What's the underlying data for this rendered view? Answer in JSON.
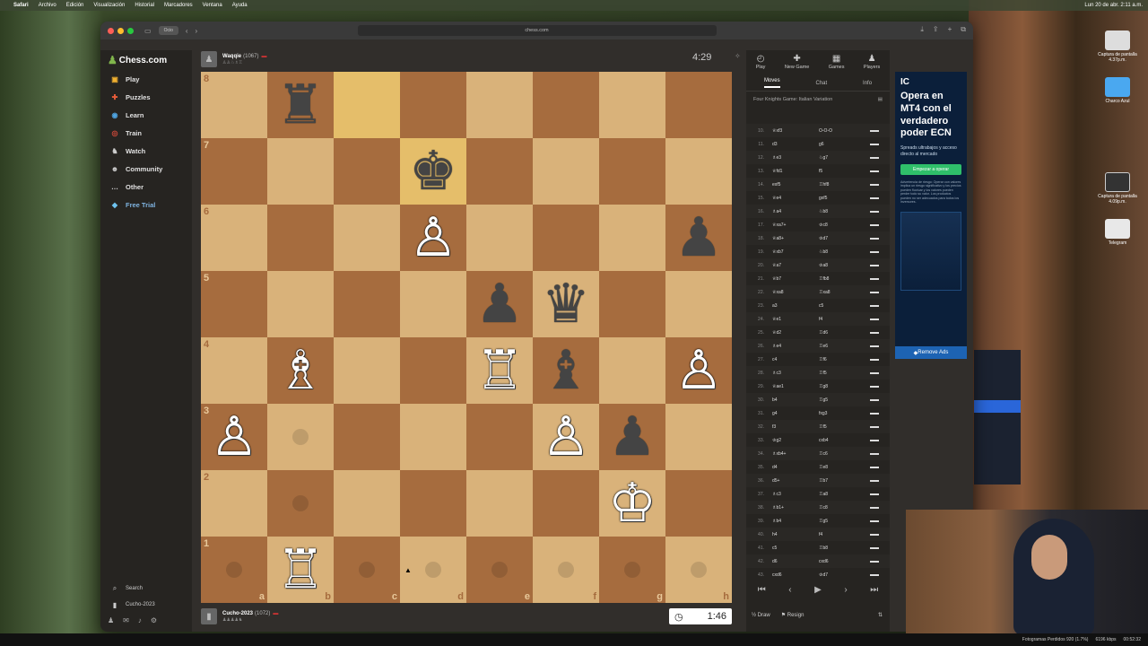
{
  "menubar": {
    "app": "Safari",
    "items": [
      "Archivo",
      "Edición",
      "Visualización",
      "Historial",
      "Marcadores",
      "Ventana",
      "Ayuda"
    ],
    "clock": "Lun 20 de abr. 2:11 a.m."
  },
  "browser": {
    "tab_group": "Ocio",
    "url": "chess.com"
  },
  "sidebar": {
    "logo": "Chess.com",
    "items": [
      {
        "label": "Play",
        "icon": "play-icon"
      },
      {
        "label": "Puzzles",
        "icon": "puzzle-icon"
      },
      {
        "label": "Learn",
        "icon": "learn-icon"
      },
      {
        "label": "Train",
        "icon": "train-icon"
      },
      {
        "label": "Watch",
        "icon": "watch-icon"
      },
      {
        "label": "Community",
        "icon": "community-icon"
      },
      {
        "label": "Other",
        "icon": "more-icon"
      },
      {
        "label": "Free Trial",
        "icon": "diamond-icon"
      }
    ],
    "search": "Search",
    "user": "Cucho-2023"
  },
  "players": {
    "top": {
      "name": "Waqqie",
      "rating": "(1067)",
      "clock": "4:29"
    },
    "bottom": {
      "name": "Cucho-2023",
      "rating": "(1072)",
      "clock": "1:46"
    }
  },
  "board": {
    "ranks": [
      "8",
      "7",
      "6",
      "5",
      "4",
      "3",
      "2",
      "1"
    ],
    "files": [
      "a",
      "b",
      "c",
      "d",
      "e",
      "f",
      "g",
      "h"
    ],
    "pieces": {
      "b8": "♜b",
      "d7": "♚b",
      "d6": "♙w",
      "h6": "♟b",
      "e5": "♟b",
      "f5": "♛b",
      "b4": "♗w",
      "e4": "♖w",
      "f4": "♝b",
      "h4": "♙w",
      "a3": "♙w",
      "f3": "♙w",
      "g3": "♟b",
      "g2": "♔w",
      "b1": "♖w"
    },
    "highlights": [
      "c8",
      "d7"
    ],
    "hints": [
      "b3",
      "b2",
      "a1",
      "c1",
      "d1",
      "e1",
      "f1",
      "g1",
      "h1"
    ]
  },
  "right_panel": {
    "top_tabs": [
      "Play",
      "New Game",
      "Games",
      "Players"
    ],
    "tabs": [
      "Moves",
      "Chat",
      "Info"
    ],
    "opening": "Four Knights Game: Italian Variation",
    "moves": [
      {
        "n": "10.",
        "w": "♕xf3",
        "b": "O-O-O"
      },
      {
        "n": "11.",
        "w": "d3",
        "b": "g6"
      },
      {
        "n": "12.",
        "w": "♗e3",
        "b": "♘g7"
      },
      {
        "n": "13.",
        "w": "♕fd1",
        "b": "f5"
      },
      {
        "n": "14.",
        "w": "exf5",
        "b": "♖hf8"
      },
      {
        "n": "15.",
        "w": "♕e4",
        "b": "gxf5"
      },
      {
        "n": "16.",
        "w": "♗a4",
        "b": "♘b8"
      },
      {
        "n": "17.",
        "w": "♕xa7+",
        "b": "♔c8"
      },
      {
        "n": "18.",
        "w": "♕a8+",
        "b": "♔d7"
      },
      {
        "n": "19.",
        "w": "♕xb7",
        "b": "♘b8"
      },
      {
        "n": "20.",
        "w": "♕a7",
        "b": "♔a8"
      },
      {
        "n": "21.",
        "w": "♕b7",
        "b": "♖fb8"
      },
      {
        "n": "22.",
        "w": "♕xa8",
        "b": "♖xa8"
      },
      {
        "n": "23.",
        "w": "a3",
        "b": "c5"
      },
      {
        "n": "24.",
        "w": "♕e1",
        "b": "f4"
      },
      {
        "n": "25.",
        "w": "♕d2",
        "b": "♖d6"
      },
      {
        "n": "26.",
        "w": "♗e4",
        "b": "♖e6"
      },
      {
        "n": "27.",
        "w": "c4",
        "b": "♖f6"
      },
      {
        "n": "28.",
        "w": "♗c3",
        "b": "♖f5"
      },
      {
        "n": "29.",
        "w": "♕ae1",
        "b": "♖g8"
      },
      {
        "n": "30.",
        "w": "b4",
        "b": "♖g5"
      },
      {
        "n": "31.",
        "w": "g4",
        "b": "fxg3"
      },
      {
        "n": "32.",
        "w": "f3",
        "b": "♖f5"
      },
      {
        "n": "33.",
        "w": "♔g2",
        "b": "cxb4"
      },
      {
        "n": "34.",
        "w": "♗xb4+",
        "b": "♖c6"
      },
      {
        "n": "35.",
        "w": "d4",
        "b": "♖e8"
      },
      {
        "n": "36.",
        "w": "d5+",
        "b": "♖b7"
      },
      {
        "n": "37.",
        "w": "♗c3",
        "b": "♖a8"
      },
      {
        "n": "38.",
        "w": "♗b1+",
        "b": "♖c8"
      },
      {
        "n": "39.",
        "w": "♗b4",
        "b": "♖g5"
      },
      {
        "n": "40.",
        "w": "h4",
        "b": "f4"
      },
      {
        "n": "41.",
        "w": "c5",
        "b": "♖b8"
      },
      {
        "n": "42.",
        "w": "d6",
        "b": "cxd6"
      },
      {
        "n": "43.",
        "w": "cxd6",
        "b": "♔d7"
      }
    ],
    "draw": "Draw",
    "resign": "Resign"
  },
  "ad": {
    "brand": "IC",
    "headline": "Opera en MT4 con el verdadero poder ECN",
    "subline": "Spreads ultrabajos y acceso directo al mercado",
    "cta": "Empezar a operar",
    "fine": "Advertencia de riesgo: Operar con valores implica un riesgo significativo y los precios pueden fluctuar y los valores pueden perder todo su valor. Los productos pueden no ser adecuados para todos los inversores.",
    "remove": "Remove Ads"
  },
  "desktop": {
    "icons": [
      "Captura de pantalla 4.37p.m.",
      "Charco Azul",
      "Captura de pantalla 4.09p.m.",
      "Telegram"
    ]
  },
  "taskbar": {
    "frames": "Fotogramas Perdidos 920 (1.7%)",
    "bitrate": "6196 kbps",
    "time": "00:52:32"
  }
}
